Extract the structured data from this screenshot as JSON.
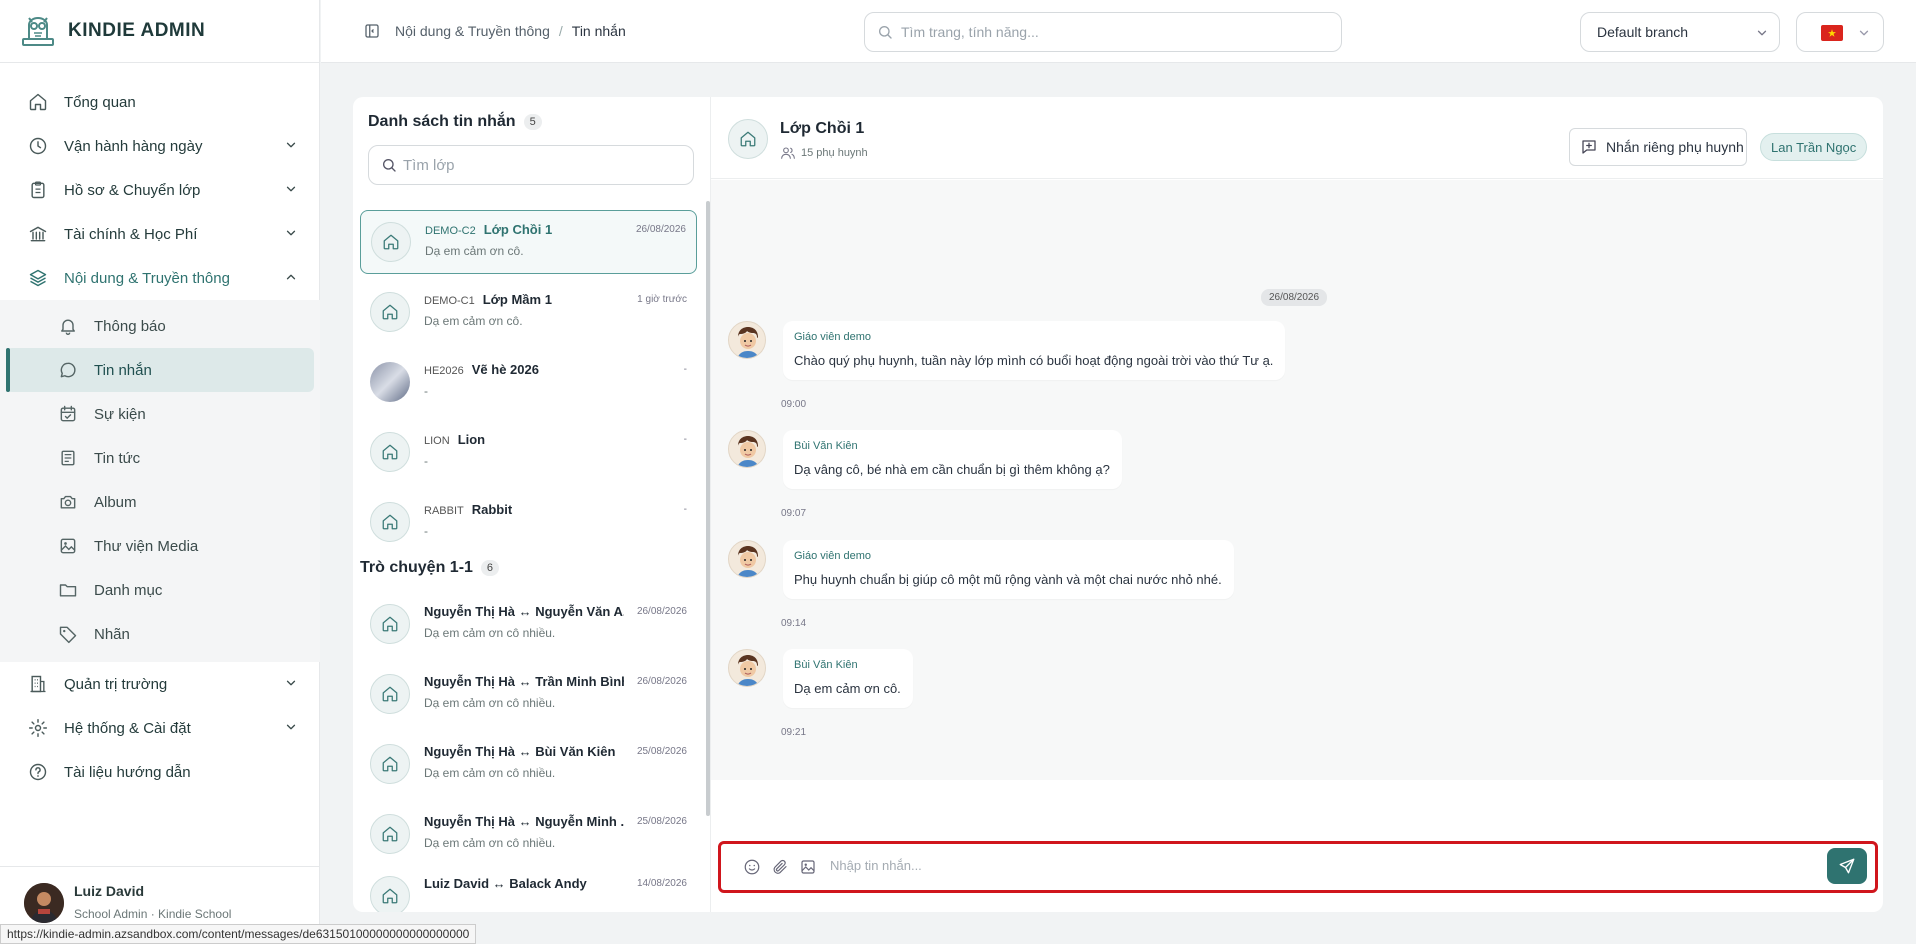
{
  "app": {
    "brand": "KINDIE ADMIN"
  },
  "sidebar": {
    "items": [
      {
        "label": "Tổng quan",
        "icon": "home-icon"
      },
      {
        "label": "Vận hành hàng ngày",
        "icon": "clock-icon"
      },
      {
        "label": "Hồ sơ & Chuyển lớp",
        "icon": "clipboard-icon"
      },
      {
        "label": "Tài chính & Học Phí",
        "icon": "bank-icon"
      },
      {
        "label": "Nội dung & Truyền thông",
        "icon": "layers-icon"
      },
      {
        "label": "Quản trị trường",
        "icon": "building-icon"
      },
      {
        "label": "Hệ thống & Cài đặt",
        "icon": "gear-icon"
      },
      {
        "label": "Tài liệu hướng dẫn",
        "icon": "help-circle-icon"
      }
    ],
    "sub": [
      {
        "label": "Thông báo",
        "icon": "bell-icon"
      },
      {
        "label": "Tin nhắn",
        "icon": "chat-bubble-icon"
      },
      {
        "label": "Sự kiện",
        "icon": "calendar-check-icon"
      },
      {
        "label": "Tin tức",
        "icon": "newspaper-icon"
      },
      {
        "label": "Album",
        "icon": "camera-icon"
      },
      {
        "label": "Thư viện Media",
        "icon": "image-icon"
      },
      {
        "label": "Danh mục",
        "icon": "folder-icon"
      },
      {
        "label": "Nhãn",
        "icon": "tag-icon"
      }
    ],
    "user": {
      "name": "Luiz David",
      "role": "School Admin · Kindie School"
    }
  },
  "statusbar": {
    "url": "https://kindie-admin.azsandbox.com/content/messages/de63150100000000000000000"
  },
  "topbar": {
    "breadcrumb": {
      "section": "Nội dung & Truyền thông",
      "sep": "/",
      "current": "Tin nhắn"
    },
    "search_placeholder": "Tìm trang, tính năng...",
    "branch": "Default branch"
  },
  "conversations": {
    "title": "Danh sách tin nhắn",
    "count": "5",
    "search_placeholder": "Tìm lớp",
    "items": [
      {
        "code": "DEMO-C2",
        "name": "Lớp Chồi 1",
        "time": "26/08/2026",
        "preview": "Dạ em cảm ơn cô."
      },
      {
        "code": "DEMO-C1",
        "name": "Lớp Mầm 1",
        "time": "1 giờ trước",
        "preview": "Dạ em cảm ơn cô."
      },
      {
        "code": "HE2026",
        "name": "Vẽ hè 2026",
        "time": "-",
        "preview": "-"
      },
      {
        "code": "LION",
        "name": "Lion",
        "time": "-",
        "preview": "-"
      },
      {
        "code": "RABBIT",
        "name": "Rabbit",
        "time": "-",
        "preview": "-"
      }
    ],
    "direct_title": "Trò chuyện 1-1",
    "direct_count": "6",
    "direct": [
      {
        "name": "Nguyễn Thị Hà ↔ Nguyễn Văn A...",
        "time": "26/08/2026",
        "preview": "Dạ em cảm ơn cô nhiều."
      },
      {
        "name": "Nguyễn Thị Hà ↔ Trần Minh Bình",
        "time": "26/08/2026",
        "preview": "Dạ em cảm ơn cô nhiều."
      },
      {
        "name": "Nguyễn Thị Hà ↔ Bùi Văn Kiên",
        "time": "25/08/2026",
        "preview": "Dạ em cảm ơn cô nhiều."
      },
      {
        "name": "Nguyễn Thị Hà ↔ Nguyễn Minh ...",
        "time": "25/08/2026",
        "preview": "Dạ em cảm ơn cô nhiều."
      },
      {
        "name": "Luiz David ↔ Balack Andy",
        "time": "14/08/2026",
        "preview": ""
      }
    ]
  },
  "chat": {
    "title": "Lớp Chồi 1",
    "subtitle": "15 phụ huynh",
    "private_button": "Nhắn riêng phụ huynh",
    "teacher": "Lan Trần Ngọc",
    "date": "26/08/2026",
    "messages": [
      {
        "sender": "Giáo viên demo",
        "text": "Chào quý phụ huynh, tuần này lớp mình có buổi hoạt động ngoài trời vào thứ Tư ạ.",
        "time": "09:00"
      },
      {
        "sender": "Bùi Văn Kiên",
        "text": "Dạ vâng cô, bé nhà em cần chuẩn bị gì thêm không ạ?",
        "time": "09:07"
      },
      {
        "sender": "Giáo viên demo",
        "text": "Phụ huynh chuẩn bị giúp cô một mũ rộng vành và một chai nước nhỏ nhé.",
        "time": "09:14"
      },
      {
        "sender": "Bùi Văn Kiên",
        "text": "Dạ em cảm ơn cô.",
        "time": "09:21"
      }
    ],
    "input_placeholder": "Nhập tin nhắn..."
  }
}
